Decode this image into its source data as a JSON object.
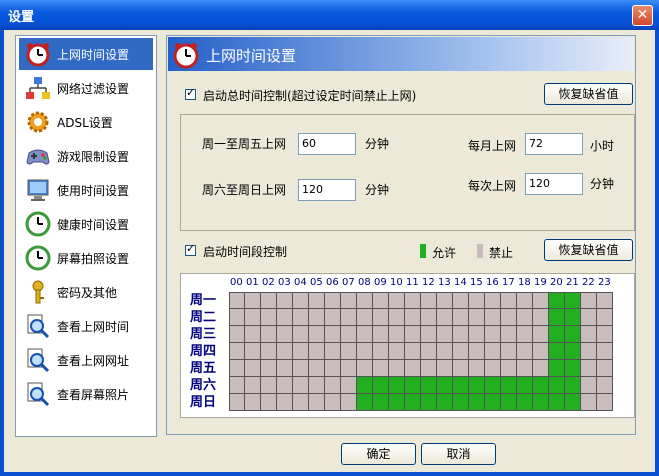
{
  "window": {
    "title": "设置",
    "close_label": "✕"
  },
  "sidebar": {
    "items": [
      {
        "label": "上网时间设置",
        "icon": "alarm-clock-icon",
        "active": true
      },
      {
        "label": "网络过滤设置",
        "icon": "network-icon",
        "active": false
      },
      {
        "label": "ADSL设置",
        "icon": "gear-icon",
        "active": false
      },
      {
        "label": "游戏限制设置",
        "icon": "gamepad-icon",
        "active": false
      },
      {
        "label": "使用时间设置",
        "icon": "monitor-icon",
        "active": false
      },
      {
        "label": "健康时间设置",
        "icon": "clock-icon",
        "active": false
      },
      {
        "label": "屏幕拍照设置",
        "icon": "clock-icon",
        "active": false
      },
      {
        "label": "密码及其他",
        "icon": "key-icon",
        "active": false
      },
      {
        "label": "查看上网时间",
        "icon": "magnifier-icon",
        "active": false
      },
      {
        "label": "查看上网网址",
        "icon": "magnifier-icon",
        "active": false
      },
      {
        "label": "查看屏幕照片",
        "icon": "magnifier-icon",
        "active": false
      }
    ]
  },
  "main": {
    "header_title": "上网时间设置",
    "total_control": {
      "checkbox_label": "启动总时间控制(超过设定时间禁止上网)",
      "checked": true,
      "restore_label": "恢复缺省值",
      "weekday_label": "周一至周五上网",
      "weekday_value": "60",
      "weekday_unit": "分钟",
      "weekend_label": "周六至周日上网",
      "weekend_value": "120",
      "weekend_unit": "分钟",
      "monthly_label": "每月上网",
      "monthly_value": "72",
      "monthly_unit": "小时",
      "per_session_label": "每次上网",
      "per_session_value": "120",
      "per_session_unit": "分钟"
    },
    "period_control": {
      "checkbox_label": "启动时间段控制",
      "checked": true,
      "allow_label": "允许",
      "deny_label": "禁止",
      "allow_color": "#22b022",
      "deny_color": "#c8bcbc",
      "restore_label": "恢复缺省值",
      "hours": [
        "00",
        "01",
        "02",
        "03",
        "04",
        "05",
        "06",
        "07",
        "08",
        "09",
        "10",
        "11",
        "12",
        "13",
        "14",
        "15",
        "16",
        "17",
        "18",
        "19",
        "20",
        "21",
        "22",
        "23"
      ],
      "days": [
        "周一",
        "周二",
        "周三",
        "周四",
        "周五",
        "周六",
        "周日"
      ],
      "allowed": [
        [
          20,
          21
        ],
        [
          20,
          21
        ],
        [
          20,
          21
        ],
        [
          20,
          21
        ],
        [
          20,
          21
        ],
        [
          8,
          9,
          10,
          11,
          12,
          13,
          14,
          15,
          16,
          17,
          18,
          19,
          20,
          21
        ],
        [
          8,
          9,
          10,
          11,
          12,
          13,
          14,
          15,
          16,
          17,
          18,
          19,
          20,
          21
        ]
      ]
    }
  },
  "footer": {
    "ok_label": "确定",
    "cancel_label": "取消"
  }
}
